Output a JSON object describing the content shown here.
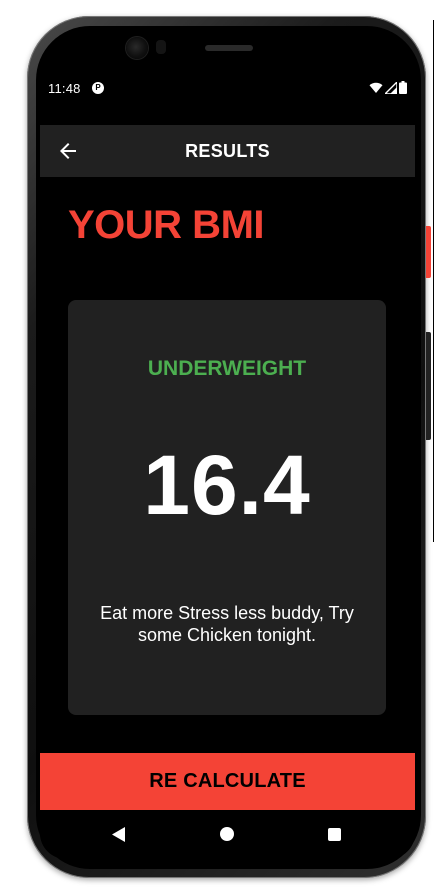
{
  "status_bar": {
    "time": "11:48",
    "app_icon": "media-app-icon",
    "icons": [
      "wifi-icon",
      "signal-icon",
      "battery-icon"
    ]
  },
  "app_bar": {
    "title": "RESULTS",
    "back_icon": "back-arrow-icon"
  },
  "heading": "YOUR BMI",
  "result": {
    "category": "UNDERWEIGHT",
    "value": "16.4",
    "advice": "Eat more Stress less buddy, Try some Chicken tonight."
  },
  "recalculate_label": "RE CALCULATE",
  "navigation": [
    "nav-back-icon",
    "nav-home-icon",
    "nav-recent-icon"
  ],
  "colors": {
    "accent": "#f44336",
    "category": "#4caf50",
    "card": "#212121",
    "background": "#000000"
  }
}
